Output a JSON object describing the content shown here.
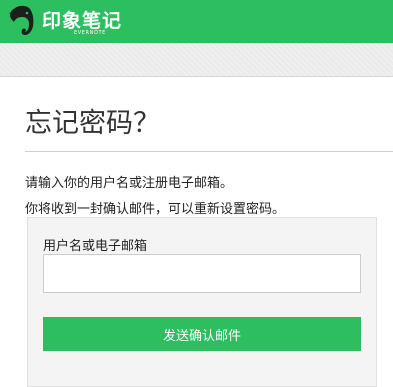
{
  "header": {
    "brand_name": "印象笔记",
    "brand_sub": "EVERNOTE",
    "logo_icon": "evernote-elephant-icon",
    "color": "#2dbe60"
  },
  "page": {
    "title": "忘记密码？",
    "description_line1": "请输入你的用户名或注册电子邮箱。",
    "description_line2": "你将收到一封确认邮件，可以重新设置密码。"
  },
  "form": {
    "field_label": "用户名或电子邮箱",
    "field_value": "",
    "field_placeholder": "",
    "submit_label": "发送确认邮件",
    "submit_color": "#2dbe60"
  }
}
